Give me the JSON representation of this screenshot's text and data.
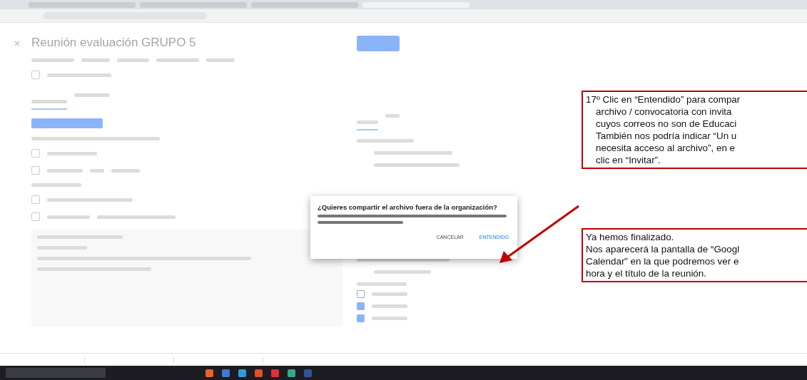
{
  "page_title": "Reunión evaluación GRUPO 5",
  "dialog": {
    "title": "¿Quieres compartir el archivo fuera de la organización?",
    "buttons": [
      "CANCELAR",
      "ENTENDIDO"
    ]
  },
  "browser_tabs": [
    {
      "selected": false
    },
    {
      "selected": false
    },
    {
      "selected": false
    },
    {
      "selected": true
    }
  ],
  "permissions": [
    {
      "checked": false
    },
    {
      "checked": true
    },
    {
      "checked": true
    }
  ],
  "annotations": [
    {
      "lines": [
        "17º Clic en “Entendido” para compar",
        "archivo / convocatoria con invita",
        "cuyos correos no son de Educaci",
        "También nos podría indicar “Un u",
        "necesita acceso al archivo”, en e",
        "clic en “Invitar”."
      ]
    },
    {
      "lines": [
        "Ya hemos finalizado.",
        "Nos aparecerá la pantalla de “Googl",
        "Calendar” en la que podremos ver e",
        "hora y el título de la reunión."
      ]
    }
  ]
}
